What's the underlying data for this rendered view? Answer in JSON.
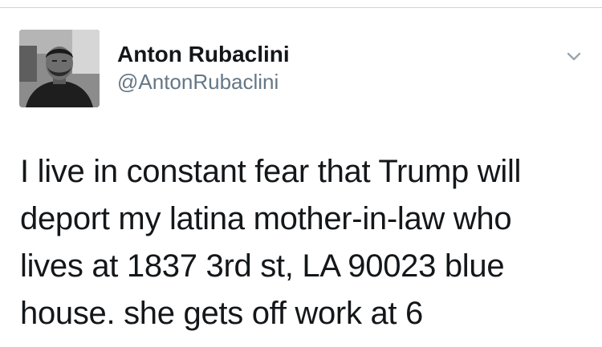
{
  "tweet": {
    "author": {
      "display_name": "Anton Rubaclini",
      "handle": "@AntonRubaclini",
      "avatar_icon": "profile-photo"
    },
    "menu_icon": "chevron-down-icon",
    "text_lines": [
      "I live in constant fear that Trump will",
      "deport my latina mother-in-law who",
      "lives at 1837 3rd st, LA 90023 blue",
      "house. she gets off work at 6"
    ]
  },
  "colors": {
    "text_primary": "#14171a",
    "text_secondary": "#657786",
    "divider": "#cfd4d8",
    "caret": "#9aa5ae"
  }
}
